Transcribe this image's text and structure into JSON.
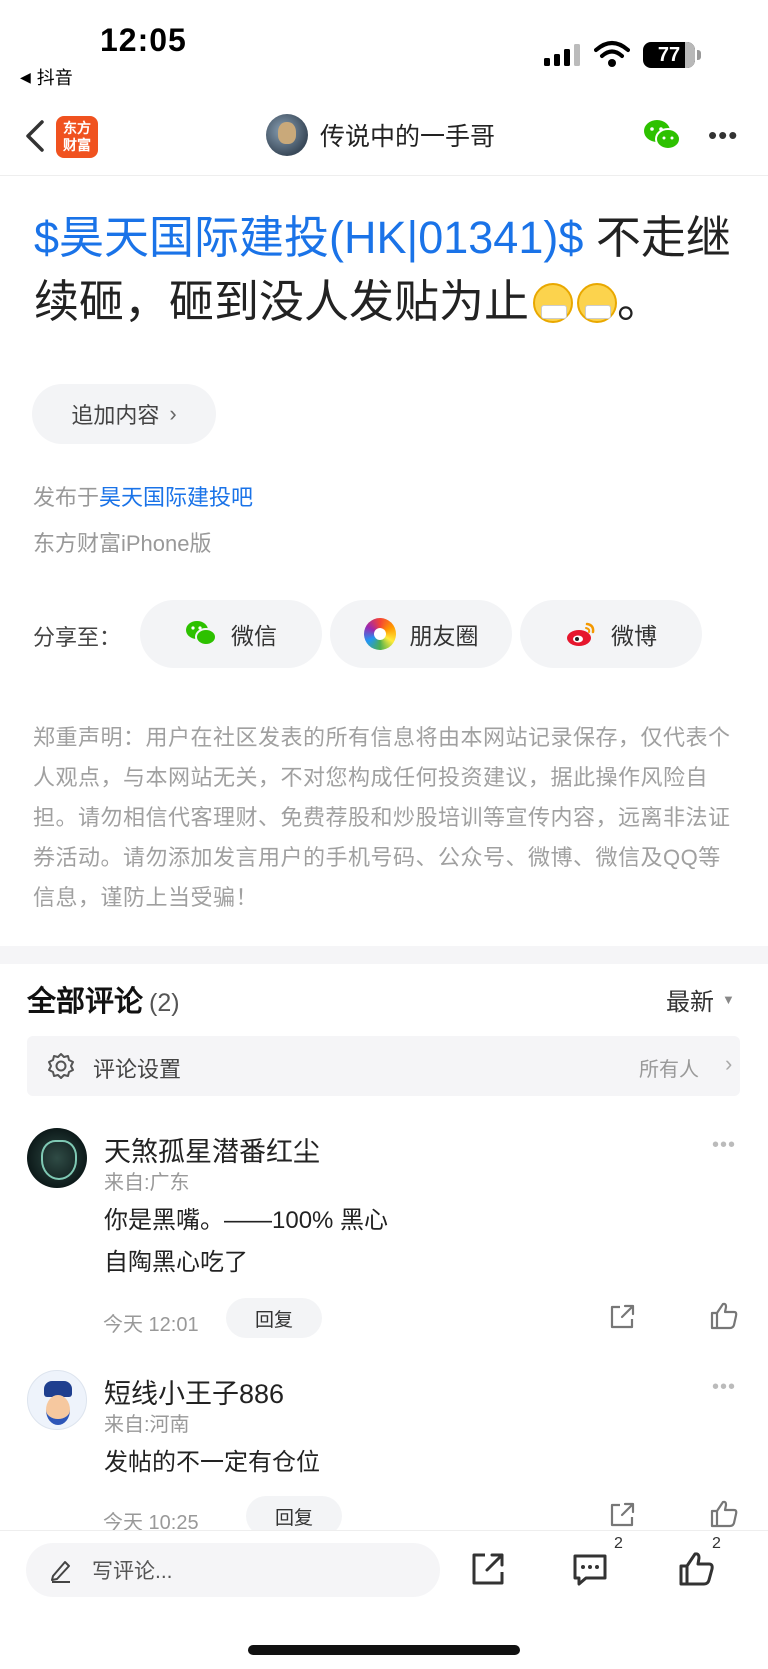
{
  "status_bar": {
    "time": "12:05",
    "back_app": "抖音",
    "battery": "77"
  },
  "nav": {
    "brand_logo_line1": "东方",
    "brand_logo_line2": "财富",
    "author_name": "传说中的一手哥"
  },
  "post": {
    "stock_tag": "$昊天国际建投(HK|01341)$",
    "title_text_1": "  不走继续砸，砸到没人发贴为止",
    "title_text_2": "。",
    "add_content_label": "追加内容",
    "publish_prefix": "发布于",
    "publish_bar": "昊天国际建投吧",
    "source": "东方财富iPhone版"
  },
  "share": {
    "label": "分享至：",
    "buttons": [
      {
        "label": "微信",
        "icon": "wechat-icon"
      },
      {
        "label": "朋友圈",
        "icon": "moments-icon"
      },
      {
        "label": "微博",
        "icon": "weibo-icon"
      }
    ]
  },
  "disclaimer": "郑重声明：用户在社区发表的所有信息将由本网站记录保存，仅代表个人观点，与本网站无关，不对您构成任何投资建议，据此操作风险自担。请勿相信代客理财、免费荐股和炒股培训等宣传内容，远离非法证券活动。请勿添加发言用户的手机号码、公众号、微博、微信及QQ等信息，谨防上当受骗！",
  "comments": {
    "title": "全部评论",
    "count": "(2)",
    "sort": "最新",
    "settings_label": "评论设置",
    "settings_value": "所有人",
    "items": [
      {
        "name": "天煞孤星潜番红尘",
        "location": "来自:广东",
        "line1": "你是黑嘴。——100% 黑心",
        "line2": "自陶黑心吃了",
        "time": "今天 12:01",
        "reply": "回复"
      },
      {
        "name": "短线小王子886",
        "location": "来自:河南",
        "line1": "发帖的不一定有仓位",
        "time": "今天 10:25",
        "reply": "回复"
      }
    ]
  },
  "bottom_bar": {
    "write_placeholder": "写评论...",
    "comment_badge": "2",
    "like_badge": "2"
  }
}
